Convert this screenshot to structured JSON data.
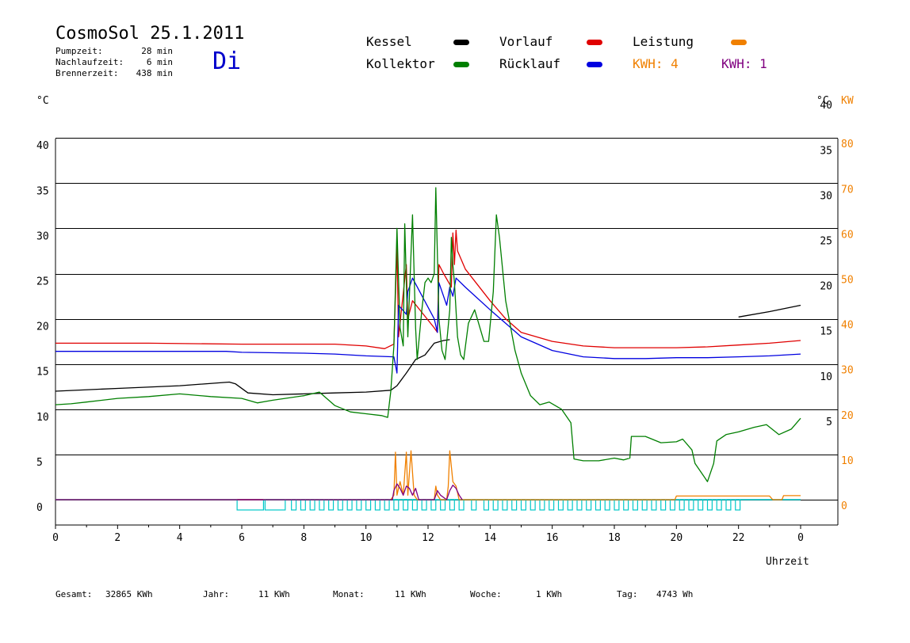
{
  "header": {
    "title": "CosmoSol 25.1.2011",
    "day": "Di",
    "day_color": "#0000cc",
    "stats": [
      {
        "label": "Pumpzeit:",
        "value": "28 min"
      },
      {
        "label": "Nachlaufzeit:",
        "value": "6 min"
      },
      {
        "label": "Brennerzeit:",
        "value": "438 min"
      }
    ]
  },
  "legend": {
    "kessel": {
      "label": "Kessel",
      "color": "#000000"
    },
    "kollektor": {
      "label": "Kollektor",
      "color": "#007f00"
    },
    "vorlauf": {
      "label": "Vorlauf",
      "color": "#e00000"
    },
    "ruecklauf": {
      "label": "Rücklauf",
      "color": "#0000e0"
    },
    "leistung": {
      "label": "Leistung",
      "color": "#f08000"
    },
    "kwh1": {
      "label": "KWH: 4",
      "color": "#f08000"
    },
    "kwh2": {
      "label": "KWH: 1",
      "color": "#800080"
    }
  },
  "axes": {
    "left_unit": "°C",
    "right_unit_c": "°C",
    "right_unit_kw": "KW",
    "x_label": "Uhrzeit"
  },
  "footer": [
    {
      "label": "Gesamt:",
      "value": "32865 KWh"
    },
    {
      "label": "Jahr:",
      "value": "11 KWh"
    },
    {
      "label": "Monat:",
      "value": "11 KWh"
    },
    {
      "label": "Woche:",
      "value": "1 KWh"
    },
    {
      "label": "Tag:",
      "value": "4743 Wh"
    }
  ],
  "chart_data": {
    "type": "line",
    "xlabel": "Uhrzeit",
    "ylabel": "°C",
    "y2label": "KW",
    "xlim": [
      0,
      24
    ],
    "ylim": [
      -2.8,
      40
    ],
    "y2lim": [
      0,
      80
    ],
    "grid": true,
    "x_ticks": [
      "0",
      "2",
      "4",
      "6",
      "8",
      "10",
      "12",
      "14",
      "16",
      "18",
      "20",
      "22",
      "0"
    ],
    "y_ticks_left": [
      "0",
      "5",
      "10",
      "15",
      "20",
      "25",
      "30",
      "35",
      "40"
    ],
    "y_ticks_right_c": [
      "5",
      "10",
      "15",
      "20",
      "25",
      "30",
      "35",
      "40"
    ],
    "y_ticks_right_kw": [
      "0",
      "10",
      "20",
      "30",
      "40",
      "50",
      "60",
      "70",
      "80"
    ],
    "series": [
      {
        "name": "Kessel",
        "color": "#000000",
        "points": [
          [
            0,
            12
          ],
          [
            2,
            12.3
          ],
          [
            4,
            12.6
          ],
          [
            5.6,
            13
          ],
          [
            5.8,
            12.8
          ],
          [
            6.2,
            11.8
          ],
          [
            7,
            11.6
          ],
          [
            8,
            11.7
          ],
          [
            9,
            11.8
          ],
          [
            10,
            11.9
          ],
          [
            10.8,
            12.1
          ],
          [
            11,
            12.6
          ],
          [
            11.3,
            14
          ],
          [
            11.6,
            15.5
          ],
          [
            11.9,
            16
          ],
          [
            12.2,
            17.3
          ],
          [
            12.4,
            17.5
          ],
          [
            12.5,
            17.6
          ],
          [
            12.7,
            17.7
          ],
          [
            12.72,
            null
          ],
          [
            21.8,
            null
          ],
          [
            22,
            20.2
          ],
          [
            23,
            20.8
          ],
          [
            24,
            21.5
          ]
        ]
      },
      {
        "name": "Vorlauf",
        "color": "#e00000",
        "points": [
          [
            0,
            17.3
          ],
          [
            3,
            17.3
          ],
          [
            6,
            17.2
          ],
          [
            8,
            17.2
          ],
          [
            9,
            17.2
          ],
          [
            10,
            17
          ],
          [
            10.6,
            16.7
          ],
          [
            10.9,
            17.2
          ],
          [
            11,
            28
          ],
          [
            11.05,
            18
          ],
          [
            11.3,
            26
          ],
          [
            11.35,
            20
          ],
          [
            11.5,
            22
          ],
          [
            12.2,
            19
          ],
          [
            12.3,
            18.5
          ],
          [
            12.35,
            26
          ],
          [
            12.5,
            25
          ],
          [
            12.75,
            23.5
          ],
          [
            12.8,
            29.5
          ],
          [
            12.85,
            26
          ],
          [
            12.9,
            29.8
          ],
          [
            12.95,
            27.5
          ],
          [
            13.2,
            25.5
          ],
          [
            14,
            22
          ],
          [
            14.5,
            20
          ],
          [
            15,
            18.5
          ],
          [
            16,
            17.5
          ],
          [
            17,
            17
          ],
          [
            18,
            16.8
          ],
          [
            19,
            16.8
          ],
          [
            20,
            16.8
          ],
          [
            21,
            16.9
          ],
          [
            22,
            17.1
          ],
          [
            23,
            17.3
          ],
          [
            24,
            17.6
          ]
        ]
      },
      {
        "name": "Rücklauf",
        "color": "#0000e0",
        "points": [
          [
            0,
            16.4
          ],
          [
            3,
            16.4
          ],
          [
            5.5,
            16.4
          ],
          [
            6,
            16.3
          ],
          [
            8,
            16.2
          ],
          [
            9,
            16.1
          ],
          [
            10,
            15.9
          ],
          [
            10.9,
            15.8
          ],
          [
            11,
            14
          ],
          [
            11.05,
            21.5
          ],
          [
            11.3,
            20.5
          ],
          [
            11.35,
            23
          ],
          [
            11.5,
            24.5
          ],
          [
            12.2,
            20
          ],
          [
            12.3,
            18.5
          ],
          [
            12.35,
            24
          ],
          [
            12.6,
            21.5
          ],
          [
            12.7,
            23.5
          ],
          [
            12.8,
            22.5
          ],
          [
            12.9,
            24.5
          ],
          [
            13.2,
            23.5
          ],
          [
            14,
            21
          ],
          [
            14.5,
            19.5
          ],
          [
            15,
            18
          ],
          [
            16,
            16.5
          ],
          [
            17,
            15.8
          ],
          [
            18,
            15.6
          ],
          [
            19,
            15.6
          ],
          [
            20,
            15.7
          ],
          [
            21,
            15.7
          ],
          [
            22,
            15.8
          ],
          [
            23,
            15.9
          ],
          [
            24,
            16.1
          ]
        ]
      },
      {
        "name": "Kollektor",
        "color": "#007f00",
        "points": [
          [
            0,
            10.5
          ],
          [
            0.5,
            10.6
          ],
          [
            1,
            10.8
          ],
          [
            2,
            11.2
          ],
          [
            3,
            11.4
          ],
          [
            4,
            11.7
          ],
          [
            5,
            11.4
          ],
          [
            6,
            11.2
          ],
          [
            6.5,
            10.7
          ],
          [
            7,
            11
          ],
          [
            8,
            11.5
          ],
          [
            8.5,
            11.9
          ],
          [
            9,
            10.4
          ],
          [
            9.5,
            9.7
          ],
          [
            10,
            9.5
          ],
          [
            10.5,
            9.3
          ],
          [
            10.7,
            9.1
          ],
          [
            10.8,
            12
          ],
          [
            10.9,
            17
          ],
          [
            11,
            30
          ],
          [
            11.1,
            19
          ],
          [
            11.2,
            17
          ],
          [
            11.25,
            30.5
          ],
          [
            11.35,
            18
          ],
          [
            11.5,
            31.5
          ],
          [
            11.6,
            19
          ],
          [
            11.65,
            15.5
          ],
          [
            11.8,
            21
          ],
          [
            11.9,
            24
          ],
          [
            12,
            24.5
          ],
          [
            12.1,
            24
          ],
          [
            12.2,
            25
          ],
          [
            12.25,
            34.5
          ],
          [
            12.35,
            20
          ],
          [
            12.45,
            16.5
          ],
          [
            12.55,
            15.5
          ],
          [
            12.7,
            21
          ],
          [
            12.75,
            29
          ],
          [
            12.8,
            26
          ],
          [
            12.85,
            24
          ],
          [
            12.95,
            18
          ],
          [
            13.05,
            16
          ],
          [
            13.15,
            15.5
          ],
          [
            13.3,
            19.5
          ],
          [
            13.5,
            21
          ],
          [
            13.8,
            17.5
          ],
          [
            13.95,
            17.5
          ],
          [
            14.1,
            23
          ],
          [
            14.2,
            31.5
          ],
          [
            14.3,
            29
          ],
          [
            14.5,
            22
          ],
          [
            14.8,
            16.5
          ],
          [
            15,
            14
          ],
          [
            15.3,
            11.5
          ],
          [
            15.6,
            10.5
          ],
          [
            15.9,
            10.8
          ],
          [
            16.3,
            10
          ],
          [
            16.6,
            8.5
          ],
          [
            16.7,
            4.5
          ],
          [
            17,
            4.3
          ],
          [
            17.5,
            4.3
          ],
          [
            18,
            4.6
          ],
          [
            18.3,
            4.4
          ],
          [
            18.5,
            4.6
          ],
          [
            18.55,
            7
          ],
          [
            19,
            7
          ],
          [
            19.5,
            6.3
          ],
          [
            20,
            6.4
          ],
          [
            20.2,
            6.7
          ],
          [
            20.5,
            5.5
          ],
          [
            20.6,
            4
          ],
          [
            20.8,
            3
          ],
          [
            21,
            2
          ],
          [
            21.2,
            4
          ],
          [
            21.3,
            6.5
          ],
          [
            21.6,
            7.2
          ],
          [
            22,
            7.5
          ],
          [
            22.5,
            8
          ],
          [
            22.9,
            8.3
          ],
          [
            23.3,
            7.2
          ],
          [
            23.7,
            7.8
          ],
          [
            24,
            9
          ]
        ]
      },
      {
        "name": "Leistung",
        "color": "#f08000",
        "axis": "right",
        "points": [
          [
            0,
            0
          ],
          [
            10.8,
            0
          ],
          [
            10.9,
            1
          ],
          [
            10.95,
            10.5
          ],
          [
            11,
            1
          ],
          [
            11.1,
            4
          ],
          [
            11.2,
            1
          ],
          [
            11.3,
            10.5
          ],
          [
            11.35,
            1
          ],
          [
            11.45,
            10.8
          ],
          [
            11.55,
            1
          ],
          [
            11.65,
            0
          ],
          [
            12.2,
            0
          ],
          [
            12.25,
            3
          ],
          [
            12.3,
            1
          ],
          [
            12.4,
            0
          ],
          [
            12.6,
            0
          ],
          [
            12.65,
            3
          ],
          [
            12.7,
            10.8
          ],
          [
            12.8,
            4
          ],
          [
            12.9,
            3
          ],
          [
            13,
            0
          ],
          [
            19.95,
            0
          ],
          [
            20,
            0.8
          ],
          [
            23,
            0.8
          ],
          [
            23.1,
            0
          ],
          [
            23.4,
            0
          ],
          [
            23.45,
            0.9
          ],
          [
            24,
            0.9
          ]
        ]
      },
      {
        "name": "KWH: 1",
        "color": "#800080",
        "axis": "right",
        "points": [
          [
            0,
            0
          ],
          [
            10.85,
            0
          ],
          [
            10.9,
            2
          ],
          [
            11,
            3.5
          ],
          [
            11.1,
            2.5
          ],
          [
            11.2,
            1
          ],
          [
            11.3,
            3
          ],
          [
            11.4,
            2.5
          ],
          [
            11.5,
            1
          ],
          [
            11.6,
            2.5
          ],
          [
            11.7,
            0
          ],
          [
            12.2,
            0
          ],
          [
            12.3,
            2
          ],
          [
            12.4,
            1
          ],
          [
            12.6,
            0
          ],
          [
            12.7,
            2
          ],
          [
            12.8,
            3.2
          ],
          [
            12.9,
            2.5
          ],
          [
            13,
            1
          ],
          [
            13.1,
            0
          ]
        ]
      }
    ],
    "pump_blocks": [
      [
        5.85,
        6.7
      ],
      [
        6.75,
        7.4
      ],
      [
        7.6,
        7.75
      ],
      [
        7.9,
        8.05
      ],
      [
        8.2,
        8.35
      ],
      [
        8.5,
        8.65
      ],
      [
        8.8,
        8.95
      ],
      [
        9.1,
        9.25
      ],
      [
        9.4,
        9.55
      ],
      [
        9.7,
        9.85
      ],
      [
        10.0,
        10.15
      ],
      [
        10.3,
        10.45
      ],
      [
        10.6,
        10.75
      ],
      [
        10.9,
        11.05
      ],
      [
        11.2,
        11.35
      ],
      [
        11.5,
        11.65
      ],
      [
        11.8,
        11.95
      ],
      [
        12.1,
        12.25
      ],
      [
        12.4,
        12.55
      ],
      [
        12.7,
        12.85
      ],
      [
        13.0,
        13.15
      ],
      [
        13.4,
        13.55
      ],
      [
        13.8,
        13.95
      ],
      [
        14.1,
        14.25
      ],
      [
        14.4,
        14.55
      ],
      [
        14.7,
        14.85
      ],
      [
        15.0,
        15.15
      ],
      [
        15.3,
        15.45
      ],
      [
        15.6,
        15.75
      ],
      [
        15.9,
        16.05
      ],
      [
        16.2,
        16.35
      ],
      [
        16.5,
        16.65
      ],
      [
        16.8,
        16.95
      ],
      [
        17.1,
        17.25
      ],
      [
        17.4,
        17.55
      ],
      [
        17.7,
        17.85
      ],
      [
        18.0,
        18.15
      ],
      [
        18.3,
        18.45
      ],
      [
        18.6,
        18.75
      ],
      [
        18.9,
        19.05
      ],
      [
        19.2,
        19.35
      ],
      [
        19.5,
        19.65
      ],
      [
        19.8,
        19.95
      ],
      [
        20.1,
        20.25
      ],
      [
        20.4,
        20.55
      ],
      [
        20.7,
        20.85
      ],
      [
        21.0,
        21.15
      ],
      [
        21.3,
        21.45
      ],
      [
        21.6,
        21.75
      ],
      [
        21.9,
        22.05
      ]
    ],
    "pump_color": "#00c8c8",
    "burner_color": "#cc0066"
  }
}
